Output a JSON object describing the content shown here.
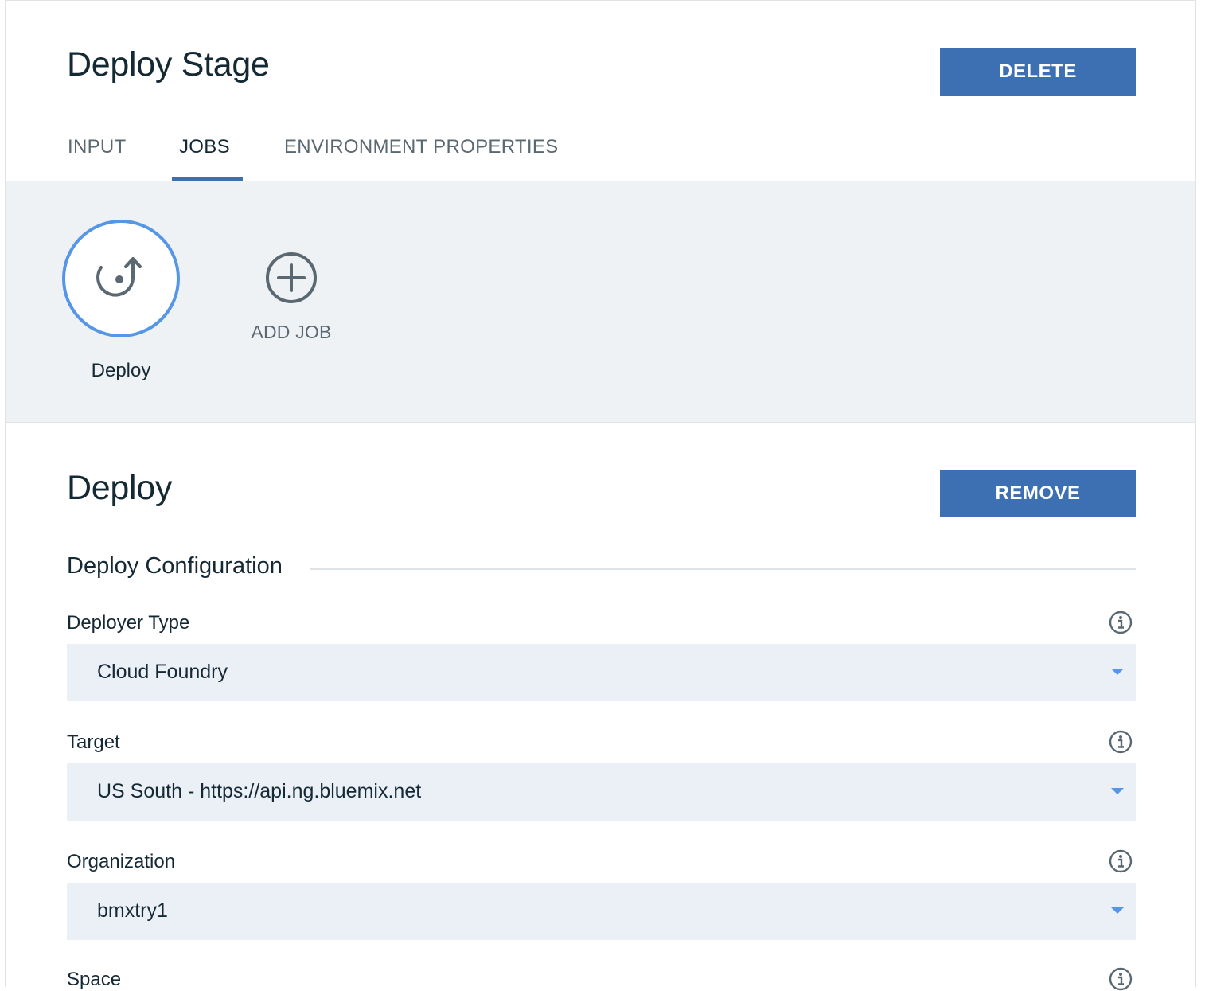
{
  "header": {
    "title": "Deploy Stage",
    "delete_label": "DELETE"
  },
  "tabs": [
    {
      "label": "INPUT",
      "active": false
    },
    {
      "label": "JOBS",
      "active": true
    },
    {
      "label": "ENVIRONMENT PROPERTIES",
      "active": false
    }
  ],
  "jobs": {
    "items": [
      {
        "label": "Deploy",
        "icon": "deploy-icon",
        "selected": true
      }
    ],
    "add_label": "ADD JOB"
  },
  "job_detail": {
    "title": "Deploy",
    "remove_label": "REMOVE",
    "section_heading": "Deploy Configuration",
    "fields": [
      {
        "label": "Deployer Type",
        "value": "Cloud Foundry"
      },
      {
        "label": "Target",
        "value": "US South - https://api.ng.bluemix.net"
      },
      {
        "label": "Organization",
        "value": "bmxtry1"
      },
      {
        "label": "Space",
        "value": ""
      }
    ]
  },
  "colors": {
    "accent": "#3d70b2",
    "highlight": "#5596e6",
    "select_bg": "#ebf0f7",
    "jobs_bg": "#eff2f5"
  }
}
